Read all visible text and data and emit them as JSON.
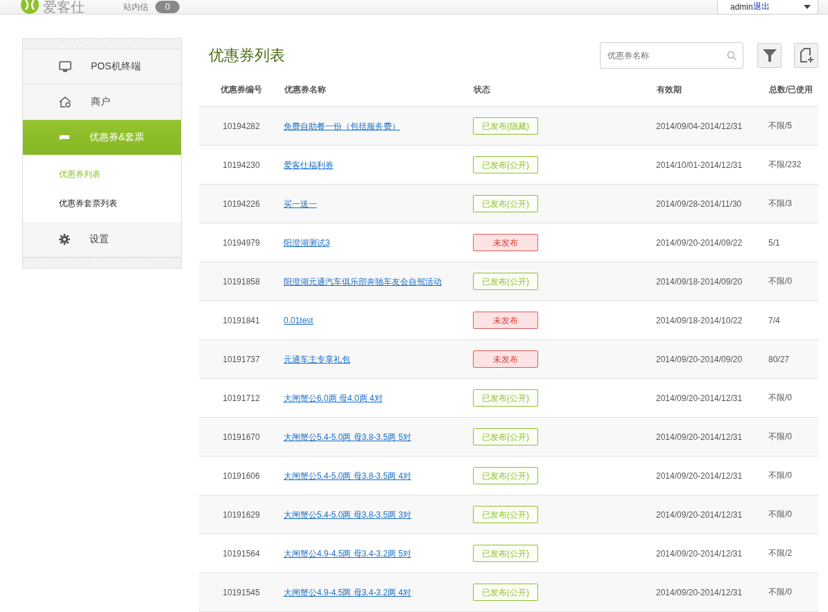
{
  "header": {
    "logo_text": "爱客仕",
    "messages_label": "站内信",
    "messages_count": "0",
    "user": "admin",
    "logout": "退出"
  },
  "sidebar": {
    "items": [
      {
        "label": "POS机终端",
        "selected": false
      },
      {
        "label": "商户",
        "selected": false
      },
      {
        "label": "优惠券&套票",
        "selected": true,
        "children": [
          {
            "label": "优惠券列表",
            "selected": true
          },
          {
            "label": "优惠券套票列表",
            "selected": false
          }
        ]
      },
      {
        "label": "设置",
        "selected": false
      }
    ]
  },
  "page_title": "优惠券列表",
  "search": {
    "placeholder": "优惠券名称"
  },
  "table": {
    "columns": [
      "优惠券编号",
      "优惠券名称",
      "状态",
      "有效期",
      "总数/已使用"
    ],
    "rows": [
      {
        "id": "10194282",
        "name": "免费自助餐一份（包括服务费）",
        "status": "已发布(隐藏)",
        "kind": "published",
        "validity": "2014/09/04-2014/12/31",
        "total": "不限/5"
      },
      {
        "id": "10194230",
        "name": "爱客仕福利券",
        "status": "已发布(公开)",
        "kind": "published",
        "validity": "2014/10/01-2014/12/31",
        "total": "不限/232"
      },
      {
        "id": "10194226",
        "name": "买一送一",
        "status": "已发布(公开)",
        "kind": "published",
        "validity": "2014/09/28-2014/11/30",
        "total": "不限/3"
      },
      {
        "id": "10194979",
        "name": "阳澄湖测试3",
        "status": "未发布",
        "kind": "unpublished",
        "validity": "2014/09/20-2014/09/22",
        "total": "5/1"
      },
      {
        "id": "10191858",
        "name": "阳澄湖元通汽车俱乐部奔驰车友会自驾活动",
        "status": "已发布(公开)",
        "kind": "published",
        "validity": "2014/09/18-2014/09/20",
        "total": "不限/0"
      },
      {
        "id": "10191841",
        "name": "0.01test",
        "status": "未发布",
        "kind": "unpublished",
        "validity": "2014/09/18-2014/10/22",
        "total": "7/4"
      },
      {
        "id": "10191737",
        "name": "元通车主专享礼包",
        "status": "未发布",
        "kind": "unpublished",
        "validity": "2014/09/20-2014/09/20",
        "total": "80/27"
      },
      {
        "id": "10191712",
        "name": "大闸蟹公6.0两 母4.0两 4对",
        "status": "已发布(公开)",
        "kind": "published",
        "validity": "2014/09/20-2014/12/31",
        "total": "不限/0"
      },
      {
        "id": "10191670",
        "name": "大闸蟹公5.4-5.0两 母3.8-3.5两 5对",
        "status": "已发布(公开)",
        "kind": "published",
        "validity": "2014/09/20-2014/12/31",
        "total": "不限/0"
      },
      {
        "id": "10191606",
        "name": "大闸蟹公5.4-5.0两 母3.8-3.5两 4对",
        "status": "已发布(公开)",
        "kind": "published",
        "validity": "2014/09/20-2014/12/31",
        "total": "不限/0"
      },
      {
        "id": "10191629",
        "name": "大闸蟹公5.4-5.0两 母3.8-3.5两 3对",
        "status": "已发布(公开)",
        "kind": "published",
        "validity": "2014/09/20-2014/12/31",
        "total": "不限/0"
      },
      {
        "id": "10191564",
        "name": "大闸蟹公4.9-4.5两 母3.4-3.2两 5对",
        "status": "已发布(公开)",
        "kind": "published",
        "validity": "2014/09/20-2014/12/31",
        "total": "不限/2"
      },
      {
        "id": "10191545",
        "name": "大闸蟹公4.9-4.5两 母3.4-3.2两 4对",
        "status": "已发布(公开)",
        "kind": "published",
        "validity": "2014/09/20-2014/12/31",
        "total": "不限/0"
      }
    ]
  }
}
